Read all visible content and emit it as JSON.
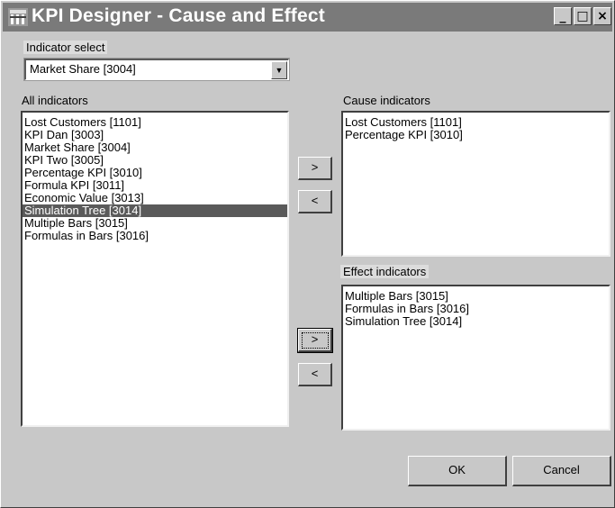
{
  "window": {
    "title": "KPI Designer - Cause and Effect",
    "minimize_glyph": "_",
    "maximize_glyph": "□",
    "close_glyph": "×"
  },
  "indicator_select": {
    "label": "Indicator select",
    "value": "Market Share [3004]",
    "arrow_glyph": "▼"
  },
  "all_indicators": {
    "label": "All indicators",
    "items": [
      "Lost Customers  [1101]",
      "KPI Dan [3003]",
      "Market Share [3004]",
      "KPI Two [3005]",
      "Percentage KPI [3010]",
      "Formula KPI [3011]",
      "Economic Value [3013]",
      "Simulation Tree [3014]",
      "Multiple Bars [3015]",
      "Formulas in Bars [3016]"
    ],
    "selected_index": 7
  },
  "cause_indicators": {
    "label": "Cause indicators",
    "items": [
      "Lost Customers  [1101]",
      "Percentage KPI [3010]"
    ]
  },
  "effect_indicators": {
    "label": "Effect indicators",
    "items": [
      "Multiple Bars [3015]",
      "Formulas in Bars [3016]",
      "Simulation Tree [3014]"
    ]
  },
  "buttons": {
    "add_cause": ">",
    "remove_cause": "<",
    "add_effect": ">",
    "remove_effect": "<",
    "ok": "OK",
    "cancel": "Cancel"
  }
}
